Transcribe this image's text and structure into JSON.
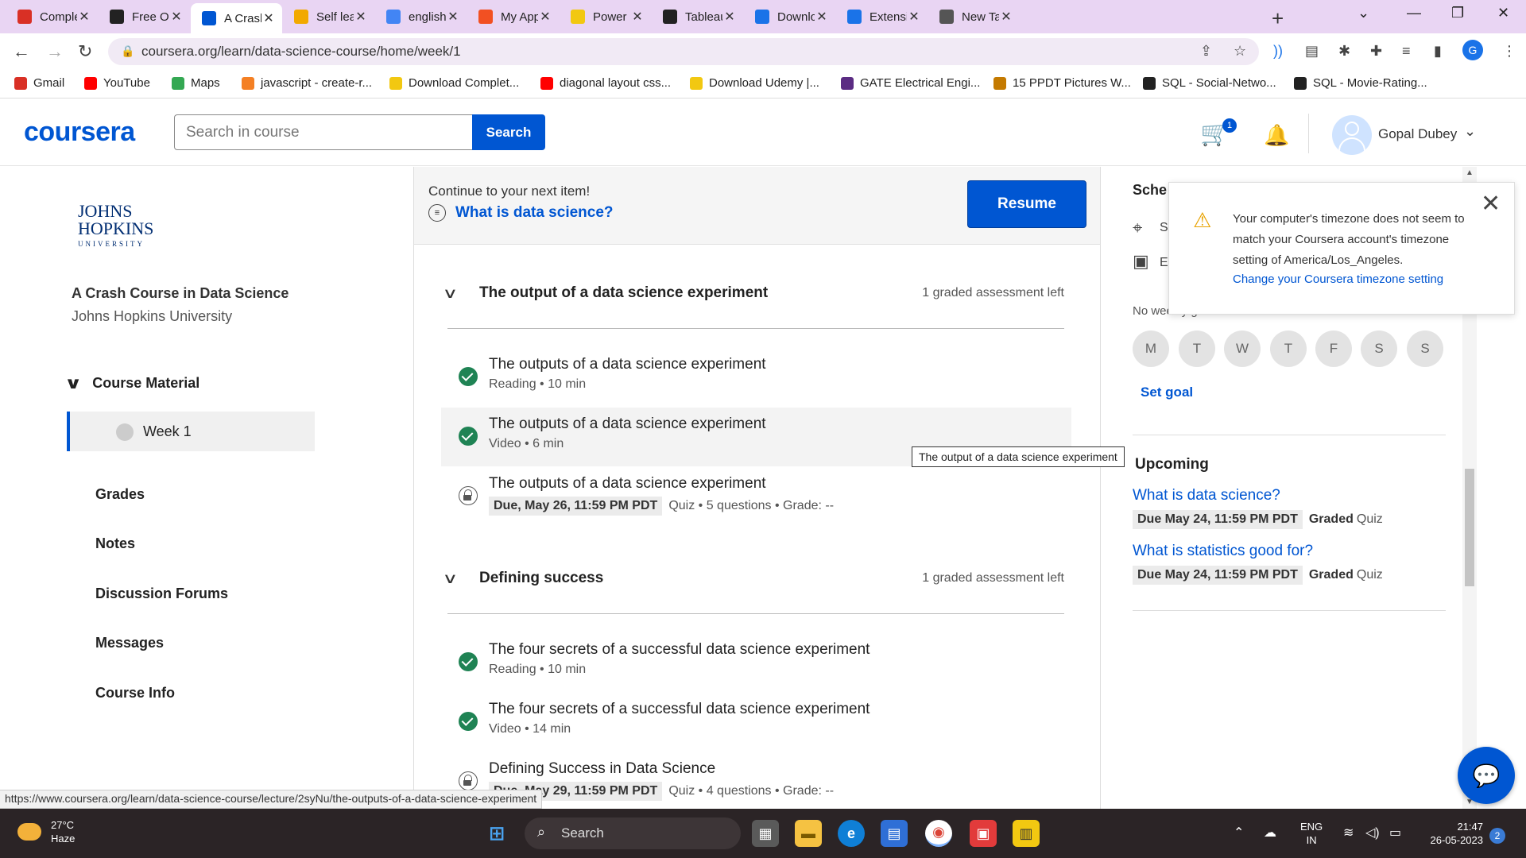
{
  "browser": {
    "tabs": [
      {
        "title": "Complete",
        "favicon": "gmail-icon",
        "color": "#d93025",
        "active": false
      },
      {
        "title": "Free Onli",
        "favicon": "site-icon",
        "color": "#222222",
        "active": false
      },
      {
        "title": "A Crash C",
        "favicon": "coursera-icon",
        "color": "#0056d2",
        "active": true
      },
      {
        "title": "Self learn",
        "favicon": "chart-icon",
        "color": "#f2a900",
        "active": false
      },
      {
        "title": "english to",
        "favicon": "google-icon",
        "color": "#4285f4",
        "active": false
      },
      {
        "title": "My Apps",
        "favicon": "microsoft-icon",
        "color": "#f25022",
        "active": false
      },
      {
        "title": "Power BI",
        "favicon": "powerbi-icon",
        "color": "#f2c811",
        "active": false
      },
      {
        "title": "Tableau-D",
        "favicon": "github-icon",
        "color": "#222222",
        "active": false
      },
      {
        "title": "Downloa",
        "favicon": "download-icon",
        "color": "#1a73e8",
        "active": false
      },
      {
        "title": "Extension",
        "favicon": "puzzle-icon",
        "color": "#1a73e8",
        "active": false
      },
      {
        "title": "New Tab",
        "favicon": "chrome-icon",
        "color": "#555555",
        "active": false
      }
    ],
    "new_tab_symbol": "+",
    "url": "coursera.org/learn/data-science-course/home/week/1",
    "profile_initial": "G",
    "bookmarks": [
      {
        "label": "Gmail",
        "color": "#d93025"
      },
      {
        "label": "YouTube",
        "color": "#ff0000"
      },
      {
        "label": "Maps",
        "color": "#34a853"
      },
      {
        "label": "javascript - create-r...",
        "color": "#f48024"
      },
      {
        "label": "Download Complet...",
        "color": "#f2c811"
      },
      {
        "label": "diagonal layout css...",
        "color": "#ff0000"
      },
      {
        "label": "Download Udemy |...",
        "color": "#f2c811"
      },
      {
        "label": "GATE Electrical Engi...",
        "color": "#5b2c83"
      },
      {
        "label": "15 PPDT Pictures W...",
        "color": "#c47a00"
      },
      {
        "label": "SQL - Social-Netwo...",
        "color": "#222222"
      },
      {
        "label": "SQL - Movie-Rating...",
        "color": "#222222"
      }
    ],
    "status_url": "https://www.coursera.org/learn/data-science-course/lecture/2syNu/the-outputs-of-a-data-science-experiment"
  },
  "header": {
    "logo": "coursera",
    "search_placeholder": "Search in course",
    "search_button": "Search",
    "cart_count": "1",
    "user_name": "Gopal Dubey"
  },
  "sidebar": {
    "university_logo_line1": "JOHNS",
    "university_logo_line2": "HOPKINS",
    "university_logo_line3": "UNIVERSITY",
    "course_title": "A Crash Course in Data Science",
    "course_org": "Johns Hopkins University",
    "section_label": "Course Material",
    "week_label": "Week 1",
    "links": [
      "Grades",
      "Notes",
      "Discussion Forums",
      "Messages",
      "Course Info"
    ]
  },
  "resume": {
    "prompt": "Continue to your next item!",
    "next_item": "What is data science?",
    "button": "Resume"
  },
  "sections": [
    {
      "title": "The output of a data science experiment",
      "meta": "1 graded assessment left",
      "items": [
        {
          "title": "The outputs of a data science experiment",
          "status": "done",
          "sub": "Reading • 10 min",
          "due": ""
        },
        {
          "title": "The outputs of a data science experiment",
          "status": "done",
          "sub": "Video • 6 min",
          "due": ""
        },
        {
          "title": "The outputs of a data science experiment",
          "status": "locked",
          "sub": "Quiz • 5 questions • Grade: --",
          "due": "Due, May 26, 11:59 PM PDT"
        }
      ]
    },
    {
      "title": "Defining success",
      "meta": "1 graded assessment left",
      "items": [
        {
          "title": "The four secrets of a successful data science experiment",
          "status": "done",
          "sub": "Reading • 10 min",
          "due": ""
        },
        {
          "title": "The four secrets of a successful data science experiment",
          "status": "done",
          "sub": "Video • 14 min",
          "due": ""
        },
        {
          "title": "Defining Success in Data Science",
          "status": "locked",
          "sub": "Quiz • 4 questions • Grade: --",
          "due": "Due, May 29, 11:59 PM PDT"
        }
      ]
    }
  ],
  "tooltip": "The output of a data science experiment",
  "right_panel": {
    "schedule_label": "Sche",
    "schedule_row1": "S",
    "schedule_row2": "E",
    "no_goal": "No weekly goal set",
    "days": [
      "M",
      "T",
      "W",
      "T",
      "F",
      "S",
      "S"
    ],
    "set_goal": "Set goal",
    "upcoming_label": "Upcoming",
    "upcoming": [
      {
        "title": "What is data science?",
        "due": "Due May 24, 11:59 PM PDT",
        "graded": "Graded",
        "type": "Quiz"
      },
      {
        "title": "What is statistics good for?",
        "due": "Due May 24, 11:59 PM PDT",
        "graded": "Graded",
        "type": "Quiz"
      }
    ]
  },
  "timezone_popup": {
    "message": "Your computer's timezone does not seem to match your Coursera account's timezone setting of America/Los_Angeles.",
    "link": "Change your Coursera timezone setting"
  },
  "taskbar": {
    "temperature": "27°C",
    "weather": "Haze",
    "search": "Search",
    "lang_line1": "ENG",
    "lang_line2": "IN",
    "time": "21:47",
    "date": "26-05-2023",
    "notifications": "2"
  }
}
